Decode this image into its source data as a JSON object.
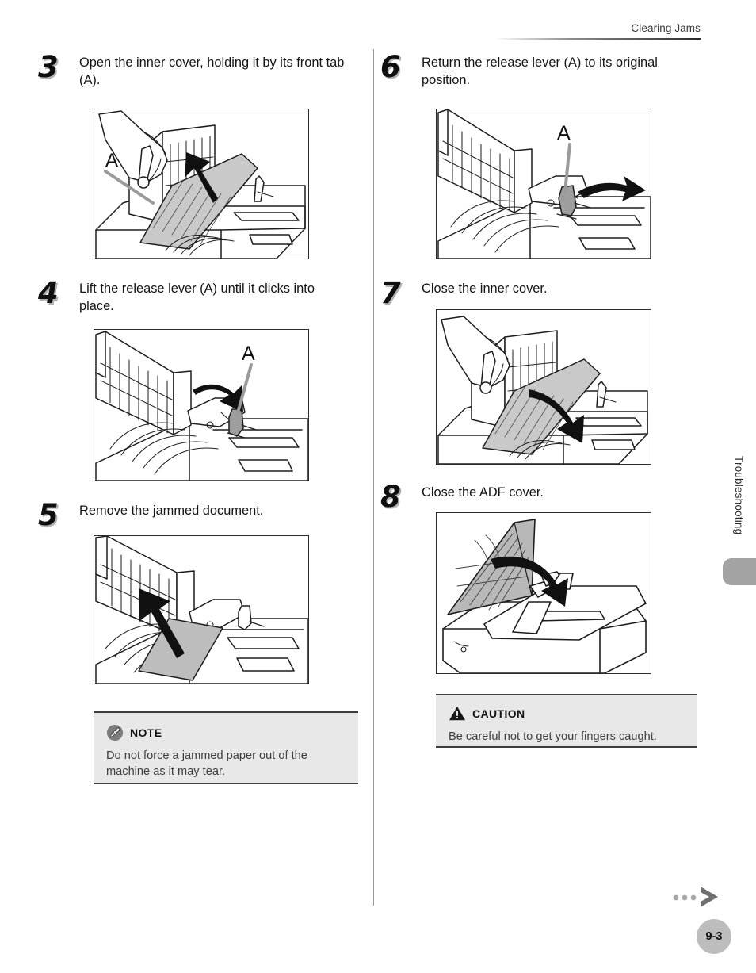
{
  "header": {
    "running_head": "Clearing Jams"
  },
  "left_column": {
    "steps": [
      {
        "number": "3",
        "text": "Open the inner cover, holding it by its front tab (A).",
        "figure_label": "A",
        "figure_name": "inner-cover-open-illustration"
      },
      {
        "number": "4",
        "text": "Lift the release lever (A) until it clicks into place.",
        "figure_label": "A",
        "figure_name": "release-lever-lift-illustration"
      },
      {
        "number": "5",
        "text": "Remove the jammed document.",
        "figure_label": "",
        "figure_name": "remove-jammed-document-illustration"
      }
    ],
    "note": {
      "icon": "note-pencil-icon",
      "title": "NOTE",
      "body": "Do not force a jammed paper out of the machine as it may tear."
    }
  },
  "right_column": {
    "steps": [
      {
        "number": "6",
        "text": "Return the release lever (A) to its original position.",
        "figure_label": "A",
        "figure_name": "release-lever-return-illustration"
      },
      {
        "number": "7",
        "text": "Close the inner cover.",
        "figure_label": "",
        "figure_name": "inner-cover-close-illustration"
      },
      {
        "number": "8",
        "text": "Close the ADF cover.",
        "figure_label": "",
        "figure_name": "adf-cover-close-illustration"
      }
    ],
    "caution": {
      "icon": "caution-triangle-icon",
      "title": "CAUTION",
      "body": "Be careful not to get your fingers caught."
    }
  },
  "sidebar": {
    "chapter_label": "Troubleshooting",
    "tab_color": "#a3a3a3"
  },
  "footer": {
    "page_number": "9-3",
    "arrow_icon": "chevron-right-icon",
    "badge_color": "#bdbdbd"
  },
  "colors": {
    "ink": "#1a1a1a",
    "callout_bg": "#e8e8e8",
    "rule": "#3c3c3c",
    "shade": "#b9b9b9"
  }
}
